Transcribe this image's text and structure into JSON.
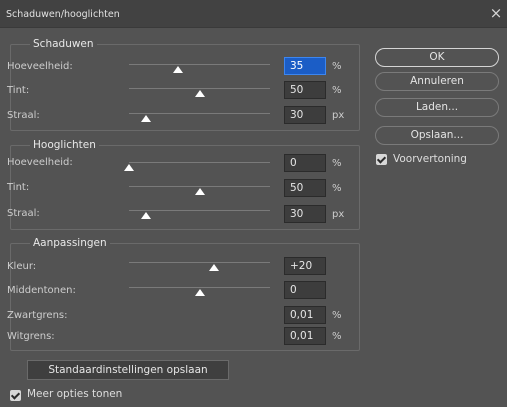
{
  "dialog": {
    "title": "Schaduwen/hooglichten",
    "close_icon": "×"
  },
  "shadows": {
    "title": "Schaduwen",
    "rows": [
      {
        "label": "Hoeveelheid:",
        "value": "35",
        "unit": "%",
        "level": 0.35
      },
      {
        "label": "Tint:",
        "value": "50",
        "unit": "%",
        "level": 0.5
      },
      {
        "label": "Straal:",
        "value": "30",
        "unit": "px",
        "level": 0.12
      }
    ]
  },
  "highlights": {
    "title": "Hooglichten",
    "rows": [
      {
        "label": "Hoeveelheid:",
        "value": "0",
        "unit": "%",
        "level": 0.0
      },
      {
        "label": "Tint:",
        "value": "50",
        "unit": "%",
        "level": 0.5
      },
      {
        "label": "Straal:",
        "value": "30",
        "unit": "px",
        "level": 0.12
      }
    ]
  },
  "adjustments": {
    "title": "Aanpassingen",
    "rows": [
      {
        "label": "Kleur:",
        "value": "+20",
        "unit": "",
        "level": 0.6
      },
      {
        "label": "Middentonen:",
        "value": "0",
        "unit": "",
        "level": 0.5
      },
      {
        "label": "Zwartgrens:",
        "value": "0,01",
        "unit": "%"
      },
      {
        "label": "Witgrens:",
        "value": "0,01",
        "unit": "%"
      }
    ]
  },
  "buttons": {
    "ok": "OK",
    "cancel": "Annuleren",
    "load": "Laden...",
    "save": "Opslaan..."
  },
  "preview": {
    "label": "Voorvertoning",
    "checked": true
  },
  "save_defaults": "Standaardinstellingen opslaan",
  "more_options": {
    "label": "Meer opties tonen",
    "checked": true
  },
  "colors": {
    "focus": "#1b5dc6",
    "background": "#535353",
    "titlebar": "#424242"
  }
}
